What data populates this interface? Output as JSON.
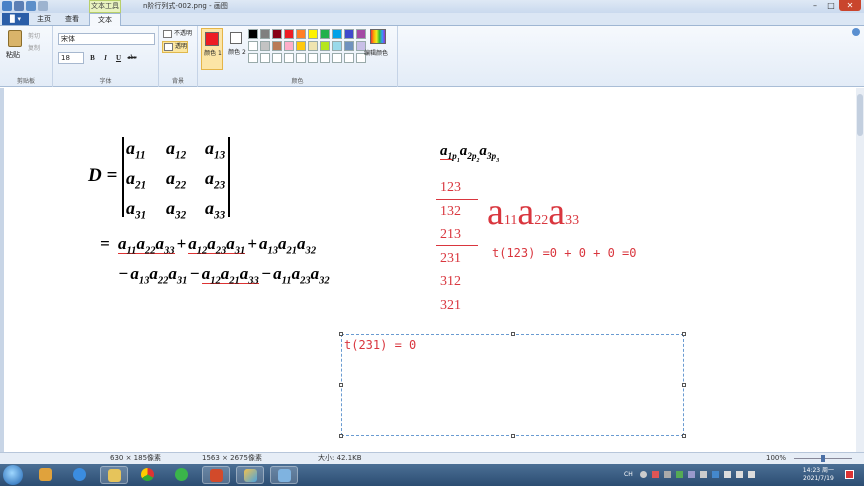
{
  "window": {
    "title": "n阶行列式-002.png - 画图",
    "context_tab_group": "文本工具",
    "controls": {
      "minimize": "–",
      "maximize": "□",
      "close": "✕"
    }
  },
  "ribbon": {
    "file_tab": "▉ ▾",
    "tabs": [
      "主页",
      "查看",
      "文本"
    ],
    "active_tab": "文本",
    "clipboard": {
      "paste": "粘贴",
      "cut": "剪切",
      "copy": "复制",
      "group": "剪贴板"
    },
    "font": {
      "name": "宋体",
      "size": "18",
      "bold": "B",
      "italic": "I",
      "underline": "U",
      "strike": "abc",
      "group": "字体"
    },
    "background": {
      "opaque": "不透明",
      "transparent": "透明",
      "group": "背景"
    },
    "colors": {
      "color1_label": "颜色 1",
      "color2_label": "颜色 2",
      "edit_colors": "编辑颜色",
      "group": "颜色",
      "color1_value": "#ed1c24",
      "color2_value": "#ffffff",
      "palette": [
        "#000000",
        "#7f7f7f",
        "#880015",
        "#ed1c24",
        "#ff7f27",
        "#fff200",
        "#22b14c",
        "#00a2e8",
        "#3f48cc",
        "#a349a4",
        "#ffffff",
        "#c3c3c3",
        "#b97a57",
        "#ffaec9",
        "#ffc90e",
        "#efe4b0",
        "#b5e61d",
        "#99d9ea",
        "#7092be",
        "#c8bfe7",
        "#ffffff",
        "#ffffff",
        "#ffffff",
        "#ffffff",
        "#ffffff",
        "#ffffff",
        "#ffffff",
        "#ffffff",
        "#ffffff",
        "#ffffff"
      ]
    }
  },
  "canvas": {
    "determinant": {
      "lhs": "D =",
      "rows": [
        [
          "a11",
          "a12",
          "a13"
        ],
        [
          "a21",
          "a22",
          "a23"
        ],
        [
          "a31",
          "a32",
          "a33"
        ]
      ]
    },
    "expansion": {
      "eq": "=",
      "line1": [
        {
          "sign": "",
          "factors": [
            "11",
            "22",
            "33"
          ],
          "underlined": true
        },
        {
          "sign": "+",
          "factors": [
            "12",
            "23",
            "31"
          ],
          "underlined": true
        },
        {
          "sign": "+",
          "factors": [
            "13",
            "21",
            "32"
          ],
          "underlined": false
        }
      ],
      "line2": [
        {
          "sign": "−",
          "factors": [
            "13",
            "22",
            "31"
          ],
          "underlined": false
        },
        {
          "sign": "−",
          "factors": [
            "12",
            "21",
            "33"
          ],
          "underlined": true
        },
        {
          "sign": "−",
          "factors": [
            "11",
            "23",
            "32"
          ],
          "underlined": false
        }
      ]
    },
    "general_term": "a1p1 a2p2 a3p3",
    "permutations": [
      "123",
      "132",
      "213",
      "231",
      "312",
      "321"
    ],
    "big_term": [
      "a",
      "11",
      "a",
      "22",
      "a",
      "33"
    ],
    "inversion_note": "t(123) =0 + 0 + 0 =0",
    "textbox_text": "t(231) = 0"
  },
  "status": {
    "selection_size": "630 × 185像素",
    "image_size": "1563 × 2675像素",
    "file_size": "大小: 42.1KB",
    "zoom": "100%"
  },
  "taskbar": {
    "time": "14:23 周一",
    "date": "2021/7/19",
    "lang": "CH"
  }
}
